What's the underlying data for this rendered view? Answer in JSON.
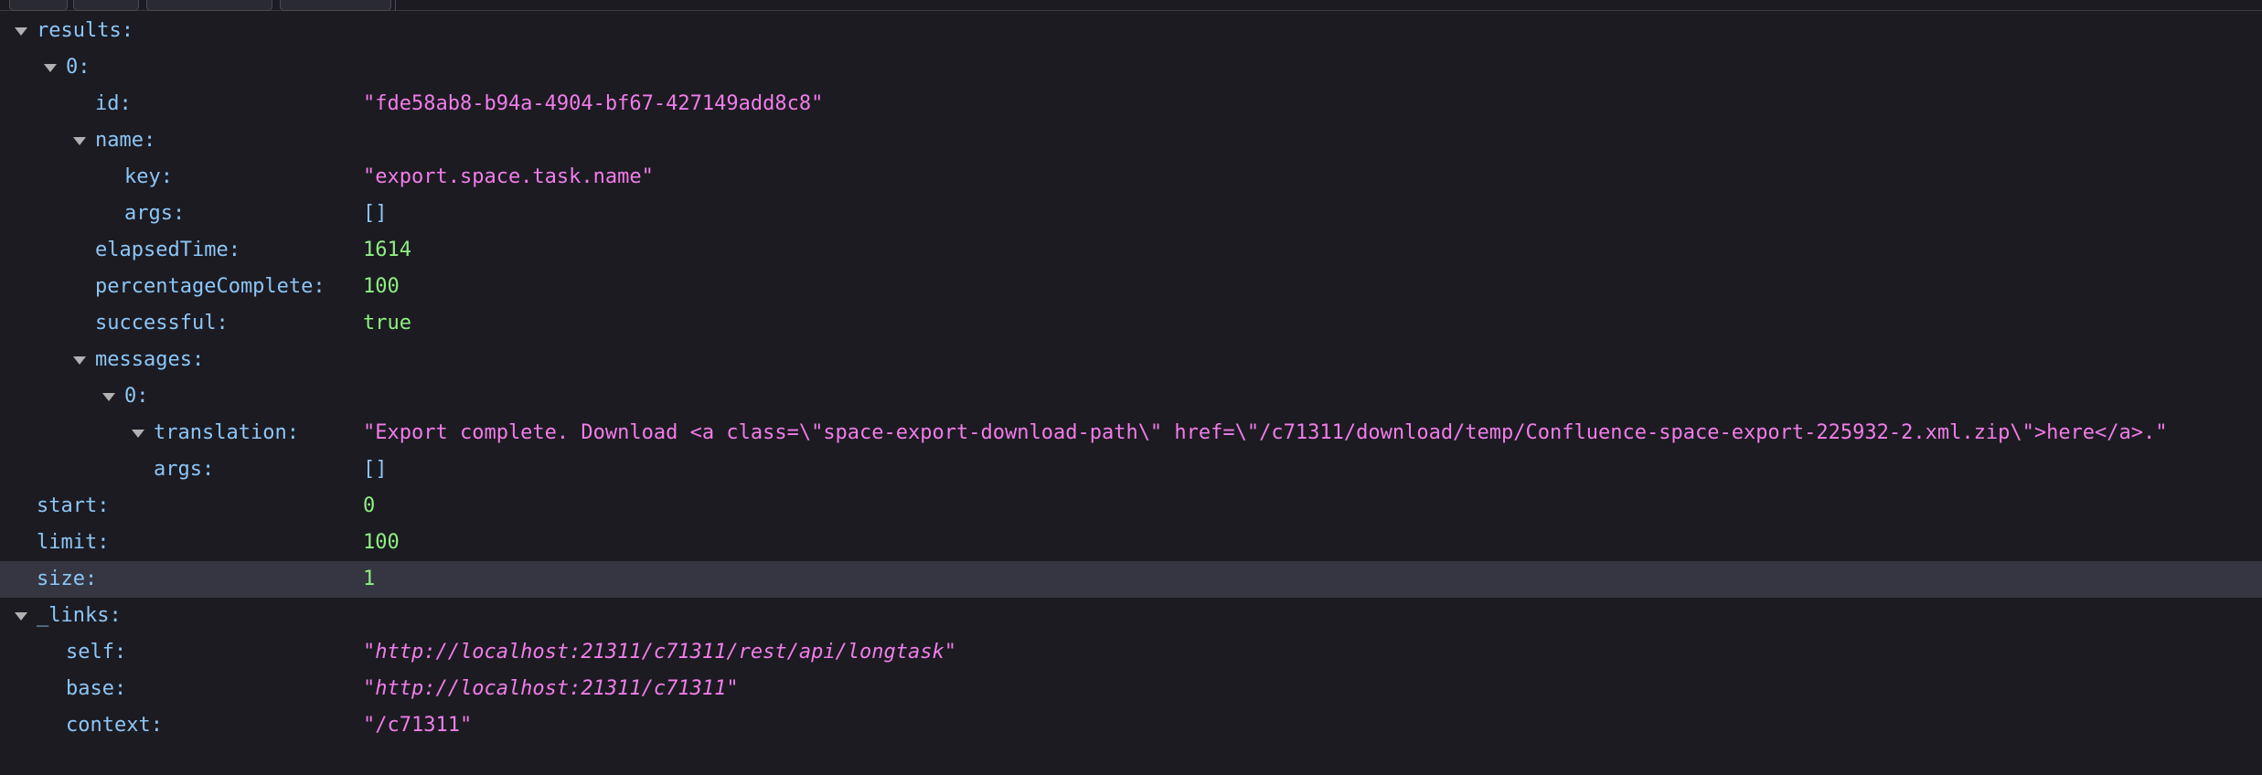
{
  "results_key": "results:",
  "item0_key": "0:",
  "id_key": "id:",
  "id_value": "\"fde58ab8-b94a-4904-bf67-427149add8c8\"",
  "name_key": "name:",
  "name_key_key": "key:",
  "name_key_value": "\"export.space.task.name\"",
  "name_args_key": "args:",
  "name_args_value": "[]",
  "elapsedTime_key": "elapsedTime:",
  "elapsedTime_value": "1614",
  "percentageComplete_key": "percentageComplete:",
  "percentageComplete_value": "100",
  "successful_key": "successful:",
  "successful_value": "true",
  "messages_key": "messages:",
  "msg0_key": "0:",
  "translation_key": "translation:",
  "translation_value": "\"Export complete. Download <a class=\\\"space-export-download-path\\\" href=\\\"/c71311/download/temp/Confluence-space-export-225932-2.xml.zip\\\">here</a>.\"",
  "msg_args_key": "args:",
  "msg_args_value": "[]",
  "start_key": "start:",
  "start_value": "0",
  "limit_key": "limit:",
  "limit_value": "100",
  "size_key": "size:",
  "size_value": "1",
  "links_key": "_links:",
  "self_key": "self:",
  "self_value": "\"http://localhost:21311/c71311/rest/api/longtask\"",
  "base_key": "base:",
  "base_value": "\"http://localhost:21311/c71311\"",
  "context_key": "context:",
  "context_value": "\"/c71311\"",
  "colors": {
    "background": "#1c1b22",
    "key": "#8cc6f6",
    "string": "#f07de8",
    "number": "#8ef081",
    "selected_row": "#353641"
  }
}
